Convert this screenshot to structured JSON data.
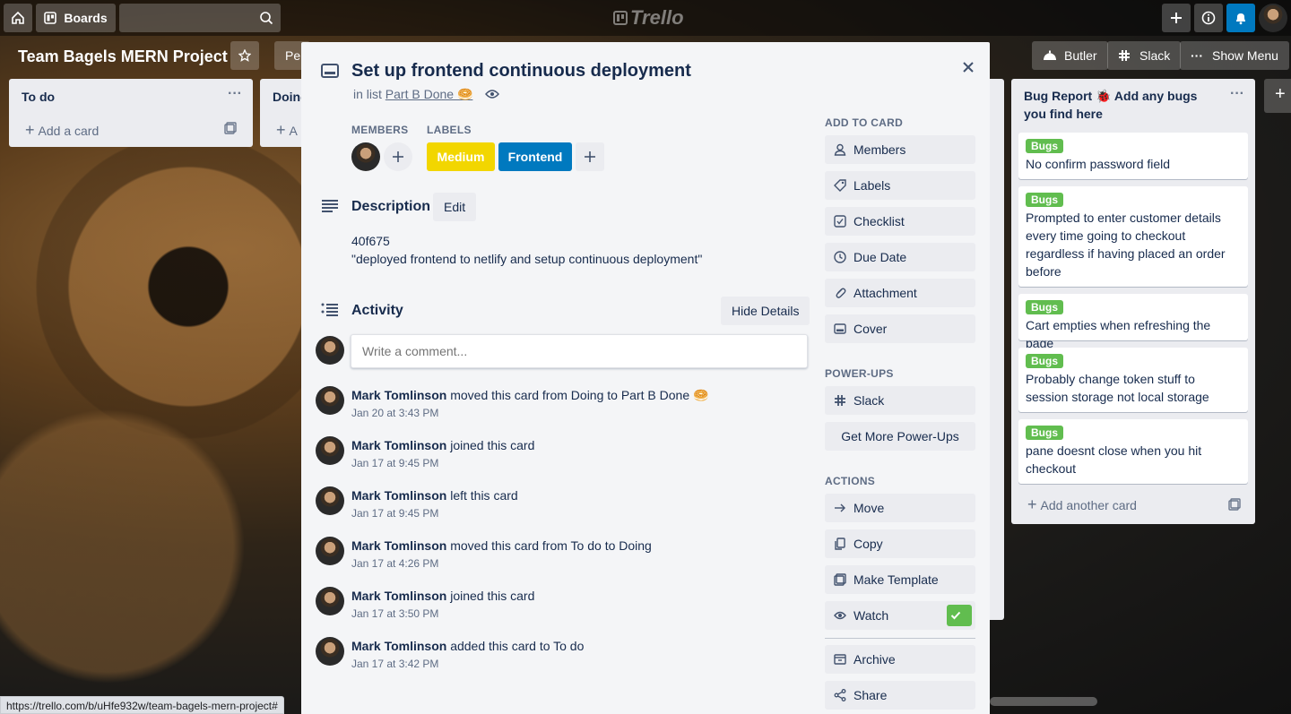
{
  "topbar": {
    "boards_label": "Boards",
    "logo": "Trello"
  },
  "board": {
    "title": "Team Bagels MERN Project",
    "peek_label": "Per",
    "butler_label": "Butler",
    "slack_label": "Slack",
    "show_menu_label": "Show Menu"
  },
  "lists": {
    "todo": {
      "title": "To do",
      "add_card": "Add a card"
    },
    "doing": {
      "title": "Doing",
      "add_card": "A"
    },
    "bugs": {
      "title": "Bug Report 🐞 Add any bugs you find here",
      "add_card": "Add another card",
      "cards": [
        {
          "label": "Bugs",
          "text": "No confirm password field"
        },
        {
          "label": "Bugs",
          "text": "Prompted to enter customer details every time going to checkout regardless if having placed an order before"
        },
        {
          "label": "Bugs",
          "text": "Cart empties when refreshing the page"
        },
        {
          "label": "Bugs",
          "text": "Probably change token stuff to session storage not local storage"
        },
        {
          "label": "Bugs",
          "text": "pane doesnt close when you hit checkout"
        }
      ]
    }
  },
  "card": {
    "title": "Set up frontend continuous deployment",
    "in_list_prefix": "in list",
    "list_name": "Part B Done 🥯",
    "members_heading": "MEMBERS",
    "labels_heading": "LABELS",
    "labels": [
      {
        "name": "Medium",
        "color": "#f2d600"
      },
      {
        "name": "Frontend",
        "color": "#0079bf"
      }
    ],
    "description_heading": "Description",
    "edit_label": "Edit",
    "description_line1": "40f675",
    "description_line2": "\"deployed frontend to netlify and setup continuous deployment\"",
    "activity_heading": "Activity",
    "hide_details_label": "Hide Details",
    "comment_placeholder": "Write a comment...",
    "activity": [
      {
        "user": "Mark Tomlinson",
        "action": "moved this card from Doing to Part B Done 🥯",
        "time": "Jan 20 at 3:43 PM"
      },
      {
        "user": "Mark Tomlinson",
        "action": "joined this card",
        "time": "Jan 17 at 9:45 PM"
      },
      {
        "user": "Mark Tomlinson",
        "action": "left this card",
        "time": "Jan 17 at 9:45 PM"
      },
      {
        "user": "Mark Tomlinson",
        "action": "moved this card from To do to Doing",
        "time": "Jan 17 at 4:26 PM"
      },
      {
        "user": "Mark Tomlinson",
        "action": "joined this card",
        "time": "Jan 17 at 3:50 PM"
      },
      {
        "user": "Mark Tomlinson",
        "action": "added this card to To do",
        "time": "Jan 17 at 3:42 PM"
      }
    ]
  },
  "sidebar": {
    "add_to_card_heading": "ADD TO CARD",
    "add_to_card": [
      "Members",
      "Labels",
      "Checklist",
      "Due Date",
      "Attachment",
      "Cover"
    ],
    "powerups_heading": "POWER-UPS",
    "slack_label": "Slack",
    "get_more_label": "Get More Power-Ups",
    "actions_heading": "ACTIONS",
    "actions": [
      "Move",
      "Copy",
      "Make Template",
      "Watch",
      "Archive",
      "Share"
    ]
  },
  "status_bar": {
    "url": "https://trello.com/b/uHfe932w/team-bagels-mern-project#"
  },
  "colors": {
    "watch_check": "#61bd4f",
    "notif": "#0079bf"
  }
}
